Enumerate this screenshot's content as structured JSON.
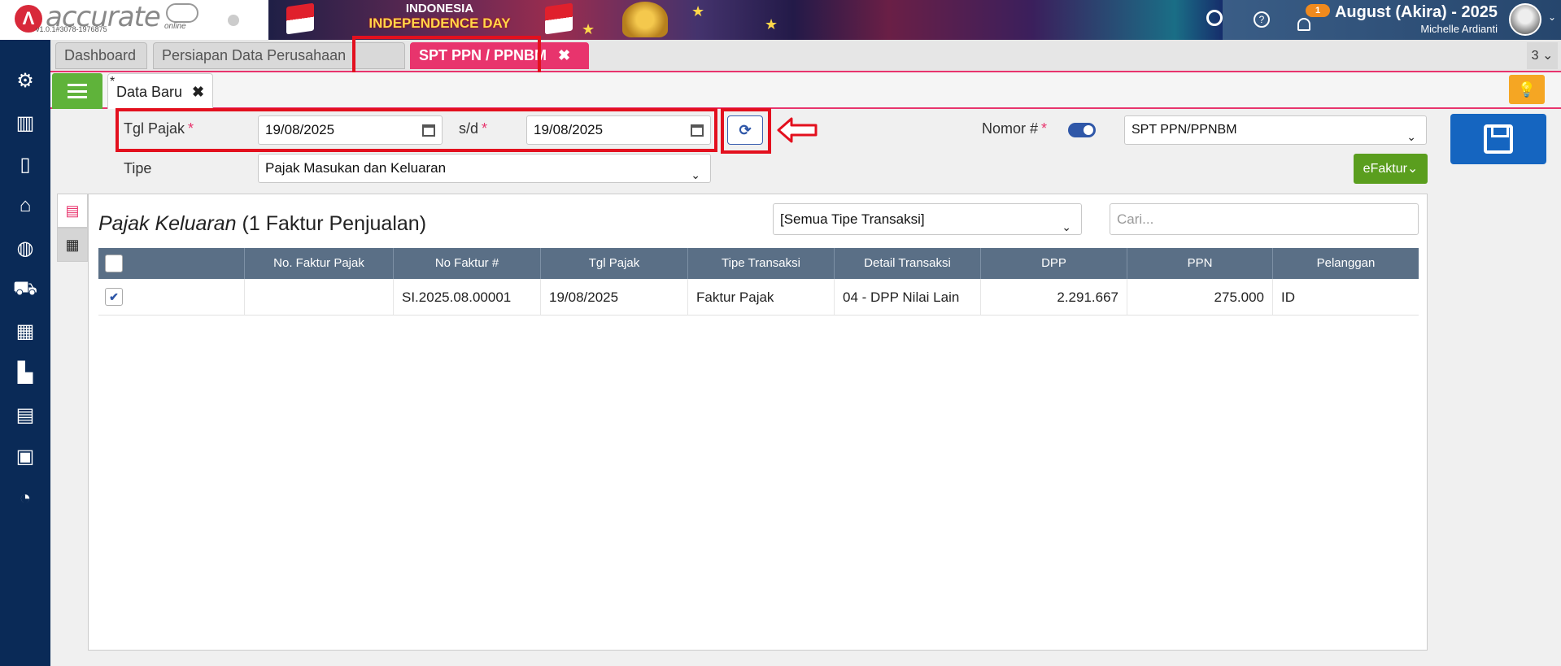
{
  "app": {
    "logo_text": "accurate",
    "logo_online": "online",
    "version": "v1.0.1#3078-1976875"
  },
  "banner": {
    "line1": "INDONESIA",
    "line2": "INDEPENDENCE DAY"
  },
  "user": {
    "period": "August (Akira) - 2025",
    "name": "Michelle Ardianti",
    "notifications": "1"
  },
  "tabs": [
    {
      "label": "Dashboard"
    },
    {
      "label": "Persiapan Data Perusahaan"
    },
    {
      "label": "SPT PPN / PPNBM",
      "active": true
    }
  ],
  "tab_count": "3",
  "subtab": {
    "marker": "*",
    "label": "Data Baru"
  },
  "form": {
    "tgl_pajak_label": "Tgl Pajak",
    "date_from": "19/08/2025",
    "sd_label": "s/d",
    "date_to": "19/08/2025",
    "tipe_label": "Tipe",
    "tipe_value": "Pajak Masukan dan Keluaran",
    "nomor_label": "Nomor #",
    "nomor_value": "SPT PPN/PPNBM",
    "efaktur_label": "eFaktur",
    "required_mark": "*"
  },
  "panel": {
    "title_italic": "Pajak Keluaran",
    "title_rest": "(1 Faktur Penjualan)",
    "filter_value": "[Semua Tipe Transaksi]",
    "search_placeholder": "Cari...",
    "columns": [
      "No. Faktur Pajak",
      "No Faktur #",
      "Tgl Pajak",
      "Tipe Transaksi",
      "Detail Transaksi",
      "DPP",
      "PPN",
      "Pelanggan"
    ],
    "rows": [
      {
        "no_faktur_pajak": "",
        "no_faktur": "SI.2025.08.00001",
        "tgl_pajak": "19/08/2025",
        "tipe_transaksi": "Faktur Pajak",
        "detail_transaksi": "04 - DPP Nilai Lain",
        "dpp": "2.291.667",
        "ppn": "275.000",
        "pelanggan": "ID",
        "checked": true
      }
    ]
  },
  "colors": {
    "accent": "#e8346d",
    "sidebar": "#0a2a57",
    "highlight": "#e3101e",
    "primary": "#1565c0",
    "success": "#5a9e1e"
  },
  "icons": {
    "sidebar": [
      "gear-icon",
      "building-icon",
      "book-icon",
      "bank-icon",
      "money-bag-icon",
      "cart-icon",
      "trolley-icon",
      "factory-icon",
      "warehouse-icon",
      "tax-icon",
      "report-icon"
    ]
  }
}
